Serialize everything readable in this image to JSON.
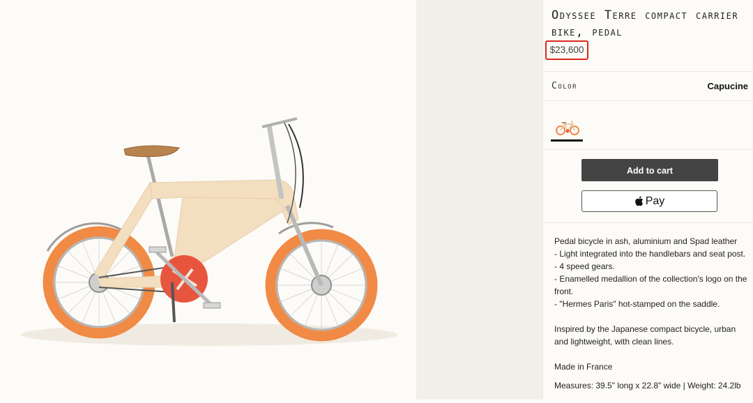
{
  "product": {
    "title": "Odyssee Terre compact carrier bike, pedal",
    "price": "$23,600"
  },
  "color": {
    "label": "Color",
    "value": "Capucine",
    "swatch_icon": "bike-thumbnail-icon"
  },
  "actions": {
    "add_to_cart": "Add to cart",
    "apple_pay": "Pay"
  },
  "description": {
    "lines": [
      "Pedal bicycle in ash, aluminium and Spad leather",
      "- Light integrated into the handlebars and seat post.",
      "- 4 speed gears.",
      "- Enamelled medallion of the collection's logo on the front.",
      "- \"Hermes Paris\" hot-stamped on the saddle."
    ],
    "inspired": "Inspired by the Japanese compact bicycle, urban and lightweight, with clean lines.",
    "made_in": "Made in France",
    "measures": "Measures: 39.5\" long x 22.8\" wide | Weight: 24.2lb"
  },
  "colors": {
    "tire": "#f08a45",
    "frame": "#f3dfbf",
    "medallion": "#e8553f",
    "saddle": "#b9834e",
    "price_highlight": "#d9281e",
    "button_dark": "#444444"
  }
}
